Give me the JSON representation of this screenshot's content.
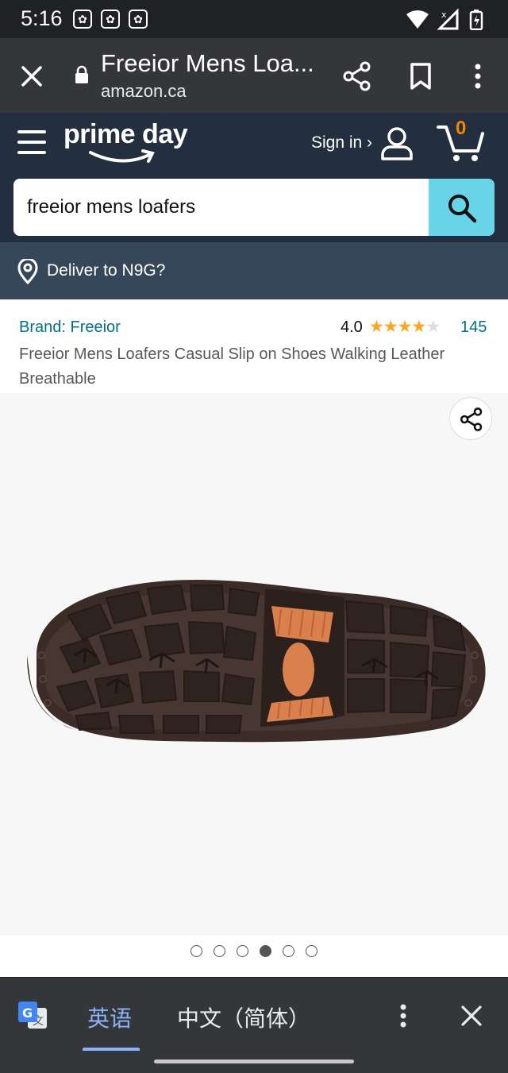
{
  "status_bar": {
    "time": "5:16",
    "notification_icons": [
      "paw-icon",
      "paw-icon",
      "paw-icon"
    ],
    "system_icons": [
      "wifi-icon",
      "signal-icon",
      "battery-icon"
    ]
  },
  "browser": {
    "page_title": "Freeior Mens Loa...",
    "url": "amazon.ca",
    "icons": [
      "close-icon",
      "lock-icon",
      "share-icon",
      "bookmark-icon",
      "more-vert-icon"
    ]
  },
  "header": {
    "logo_text": "prime day",
    "sign_in_label": "Sign in ›",
    "cart_count": "0",
    "search": {
      "value": "freeior mens loafers",
      "placeholder": ""
    }
  },
  "deliver": {
    "label": "Deliver to N9G?"
  },
  "product": {
    "brand_label": "Brand: Freeior",
    "rating_value": "4.0",
    "rating": 4.0,
    "rating_max": 5,
    "rating_count": "145",
    "title": "Freeior Mens Loafers Casual Slip on Shoes Walking Leather Breathable",
    "image_carousel": {
      "total": 6,
      "active_index": 3
    }
  },
  "translate_bar": {
    "source_lang": "英语",
    "target_lang": "中文（简体）"
  },
  "colors": {
    "header_bg": "#232f3e",
    "deliver_bg": "#37475a",
    "search_button": "#67d4e7",
    "link": "#007185",
    "star": "#ffa41c",
    "cart_count": "#f08804"
  }
}
